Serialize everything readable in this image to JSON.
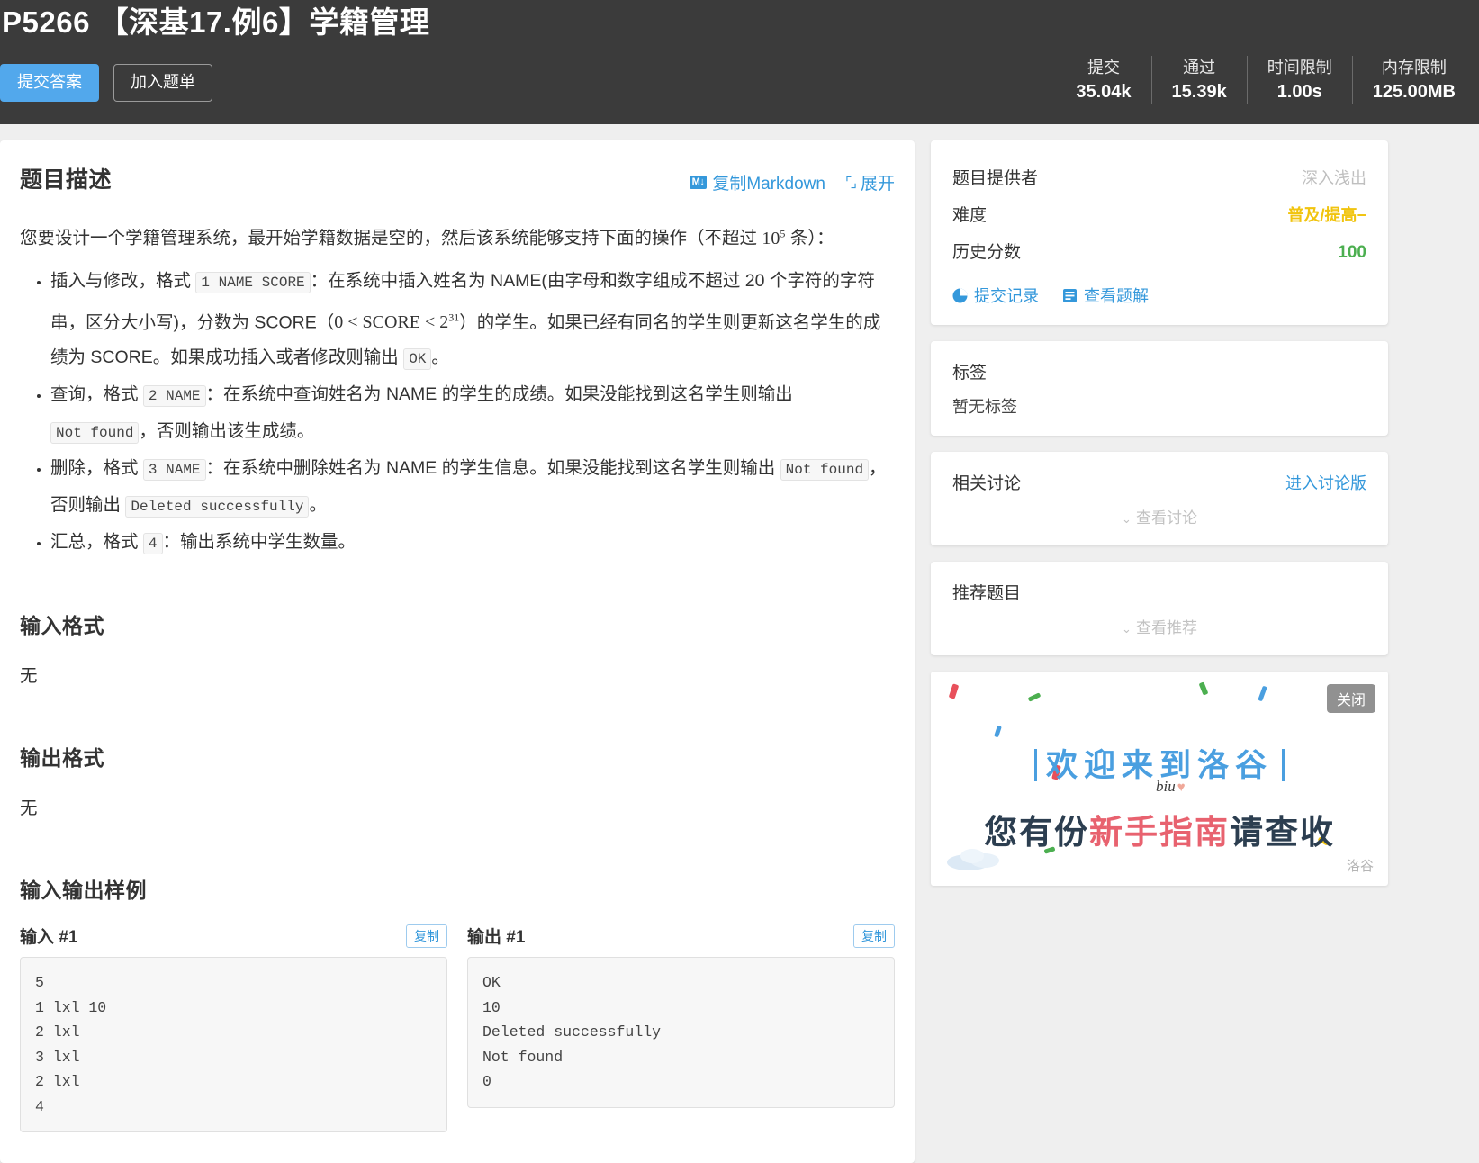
{
  "header": {
    "title": "P5266 【深基17.例6】学籍管理",
    "submit_button": "提交答案",
    "add_list_button": "加入题单",
    "stats": [
      {
        "label": "提交",
        "value": "35.04k"
      },
      {
        "label": "通过",
        "value": "15.39k"
      },
      {
        "label": "时间限制",
        "value": "1.00s"
      },
      {
        "label": "内存限制",
        "value": "125.00MB"
      }
    ]
  },
  "main": {
    "description_title": "题目描述",
    "copy_markdown": "复制Markdown",
    "expand": "展开",
    "md_badge": "M↓",
    "intro_1": "您要设计一个学籍管理系统，最开始学籍数据是空的，然后该系统能够支持下面的操作（不超过 ",
    "intro_math": "10",
    "intro_sup": "5",
    "intro_2": " 条）：",
    "bullets": [
      {
        "p1": "插入与修改，格式 ",
        "code1": "1 NAME SCORE",
        "p2": "：在系统中插入姓名为 NAME(由字母和数字组成不超过 20 个字符的字符串，区分大小写)，分数为 SCORE（",
        "math": "0 < SCORE < 2",
        "math_sup": "31",
        "p3": "）的学生。如果已经有同名的学生则更新这名学生的成绩为 SCORE。如果成功插入或者修改则输出 ",
        "code2": "OK",
        "p4": "。"
      },
      {
        "p1": "查询，格式 ",
        "code1": "2 NAME",
        "p2": "：在系统中查询姓名为 NAME 的学生的成绩。如果没能找到这名学生则输出 ",
        "code2": "Not found",
        "p3": "，否则输出该生成绩。"
      },
      {
        "p1": "删除，格式 ",
        "code1": "3 NAME",
        "p2": "：在系统中删除姓名为 NAME 的学生信息。如果没能找到这名学生则输出 ",
        "code2": "Not found",
        "p3": "，否则输出 ",
        "code3": "Deleted successfully",
        "p4": "。"
      },
      {
        "p1": "汇总，格式 ",
        "code1": "4",
        "p2": "：输出系统中学生数量。"
      }
    ],
    "input_format_title": "输入格式",
    "input_format_body": "无",
    "output_format_title": "输出格式",
    "output_format_body": "无",
    "samples_title": "输入输出样例",
    "copy_label": "复制",
    "samples": [
      {
        "input_title": "输入 #1",
        "input_text": "5\n1 lxl 10\n2 lxl\n3 lxl\n2 lxl\n4",
        "output_title": "输出 #1",
        "output_text": "OK\n10\nDeleted successfully\nNot found\n0"
      }
    ]
  },
  "sidebar": {
    "info": {
      "provider_label": "题目提供者",
      "provider_value": "深入浅出",
      "difficulty_label": "难度",
      "difficulty_value": "普及/提高−",
      "score_label": "历史分数",
      "score_value": "100",
      "records_link": "提交记录",
      "solution_link": "查看题解"
    },
    "tags": {
      "title": "标签",
      "empty": "暂无标签"
    },
    "discussion": {
      "title": "相关讨论",
      "enter_link": "进入讨论版",
      "collapse": "查看讨论"
    },
    "recommend": {
      "title": "推荐题目",
      "collapse": "查看推荐"
    },
    "promo": {
      "close": "关闭",
      "line1": "欢迎来到洛谷",
      "line2_a": "您有份",
      "line2_b": "新手指南",
      "line2_c": "请查收",
      "biu": "biu",
      "logo": "洛谷"
    }
  },
  "colors": {
    "accent": "#3498db",
    "primary_button": "#52a8ec",
    "difficulty": "#f1c40f",
    "score": "#4caf50",
    "header_bg": "#3b3b3b"
  }
}
